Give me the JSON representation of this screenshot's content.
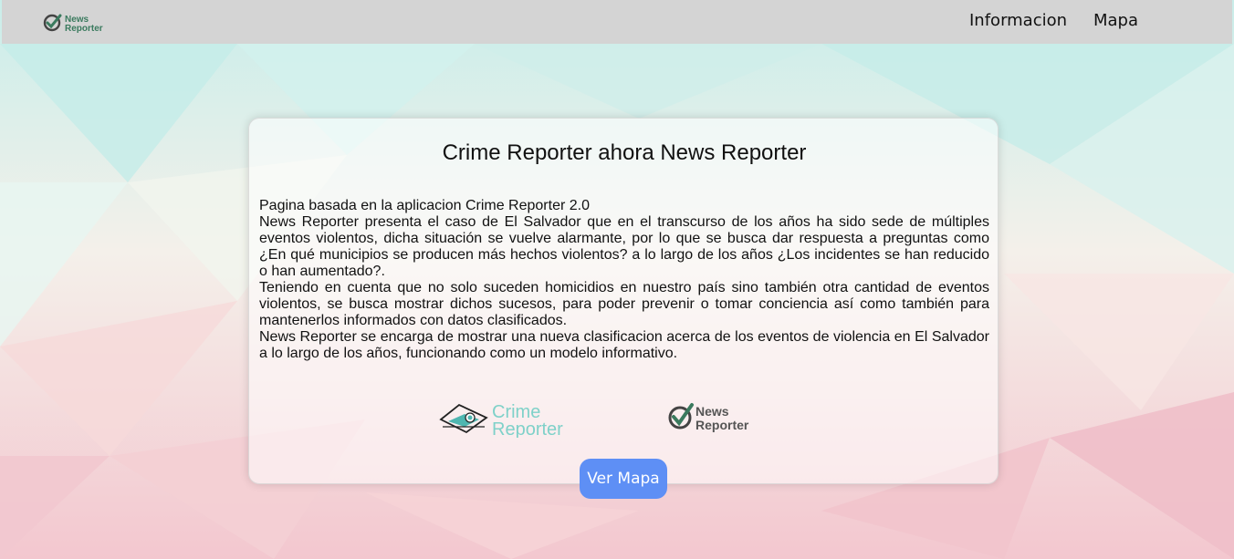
{
  "nav": {
    "logo_line1": "News",
    "logo_line2": "Reporter",
    "links": [
      "Informacion",
      "Mapa"
    ]
  },
  "card": {
    "title": "Crime Reporter ahora News Reporter",
    "paragraphs": [
      "Pagina basada en la aplicacion Crime Reporter 2.0",
      "News Reporter presenta el caso de El Salvador que en el transcurso de los años ha sido sede de múltiples eventos violentos, dicha situación se vuelve alarmante, por lo que se busca dar respuesta a preguntas como ¿En qué municipios se producen más hechos violentos? a lo largo de los años ¿Los incidentes se han reducido o han aumentado?.",
      "Teniendo en cuenta que no solo suceden homicidios en nuestro país sino también otra cantidad de eventos violentos, se busca mostrar dichos sucesos, para poder prevenir o tomar conciencia así como también para mantenerlos informados con datos clasificados.",
      "News Reporter se encarga de mostrar una nueva clasificacion acerca de los eventos de violencia en El Salvador a lo largo de los años, funcionando como un modelo informativo."
    ],
    "crime_logo_line1": "Crime",
    "crime_logo_line2": "Reporter",
    "news_logo_line1": "News",
    "news_logo_line2": "Reporter"
  },
  "button": {
    "label": "Ver Mapa"
  },
  "colors": {
    "navbar": "#d4d4d4",
    "button": "#5e8ff5",
    "brand_green": "#3a7a5e",
    "crime_teal": "#7fd1c9"
  }
}
